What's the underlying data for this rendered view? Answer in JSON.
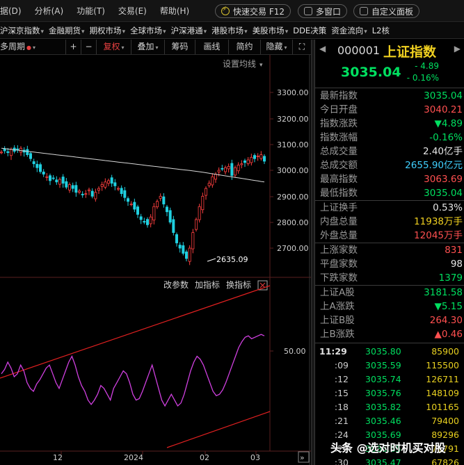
{
  "menu": {
    "items": [
      "据(D)",
      "分析(A)",
      "功能(T)",
      "交易(E)",
      "帮助(H)"
    ],
    "quick_trade": "快速交易 F12",
    "multi_window": "多窗口",
    "custom_panel": "自定义面板"
  },
  "markets": [
    {
      "label": "沪深京指数",
      "caret": true
    },
    {
      "label": "金融期货",
      "caret": true
    },
    {
      "label": "期权市场",
      "caret": true
    },
    {
      "label": "全球市场",
      "caret": true
    },
    {
      "label": "沪深港通",
      "caret": true
    },
    {
      "label": "港股市场",
      "caret": true
    },
    {
      "label": "美股市场",
      "caret": true
    },
    {
      "label": "DDE决策",
      "caret": false
    },
    {
      "label": "资金流向",
      "caret": true
    },
    {
      "label": "L2核",
      "caret": false
    }
  ],
  "toolbar": {
    "period": "多周期",
    "plus": "+",
    "minus": "−",
    "restore": "复权",
    "overlay": "叠加",
    "chips": "筹码",
    "draw": "画线",
    "simple": "简约",
    "hide": "隐藏",
    "expand": "⛶"
  },
  "chart": {
    "ma_settings": "设置均线",
    "price_axis": [
      "3300.00",
      "3200.00",
      "3100.00",
      "3000.00",
      "2900.00",
      "2800.00",
      "2700.00"
    ],
    "low_marker": "2635.09",
    "indicator_buttons": [
      "改参数",
      "加指标",
      "换指标"
    ],
    "indicator_axis": "50.00",
    "date_axis": [
      "12",
      "2024",
      "02",
      "03"
    ]
  },
  "quote": {
    "code": "000001",
    "name": "上证指数",
    "price": "3035.04",
    "change": "- 4.89",
    "change_pct": "- 0.16%",
    "stats": [
      {
        "label": "最新指数",
        "value": "3035.04",
        "color": "g"
      },
      {
        "label": "今日开盘",
        "value": "3040.21",
        "color": "r"
      },
      {
        "label": "指数涨跌",
        "value": "▼4.89",
        "color": "g"
      },
      {
        "label": "指数涨幅",
        "value": "-0.16%",
        "color": "g"
      },
      {
        "label": "总成交量",
        "value": "2.40亿手",
        "color": "w"
      },
      {
        "label": "总成交额",
        "value": "2655.90亿元",
        "color": "c"
      },
      {
        "label": "最高指数",
        "value": "3063.69",
        "color": "r"
      },
      {
        "label": "最低指数",
        "value": "3035.04",
        "color": "g"
      },
      {
        "label": "上证换手",
        "value": "0.53%",
        "color": "w"
      },
      {
        "label": "内盘总量",
        "value": "11938万手",
        "color": "y"
      },
      {
        "label": "外盘总量",
        "value": "12045万手",
        "color": "r"
      },
      {
        "label": "上涨家数",
        "value": "831",
        "color": "r"
      },
      {
        "label": "平盘家数",
        "value": "98",
        "color": "w"
      },
      {
        "label": "下跌家数",
        "value": "1379",
        "color": "g"
      },
      {
        "label": "上证A股",
        "value": "3181.58",
        "color": "g"
      },
      {
        "label": "上A涨跌",
        "value": "▼5.15",
        "color": "g"
      },
      {
        "label": "上证B股",
        "value": "264.30",
        "color": "r"
      },
      {
        "label": "上B涨跌",
        "value": "▲0.46",
        "color": "r"
      }
    ],
    "ticks": [
      {
        "time": "11:29",
        "price": "3035.80",
        "vol": "85900"
      },
      {
        "time": ":09",
        "price": "3035.59",
        "vol": "115500"
      },
      {
        "time": ":12",
        "price": "3035.74",
        "vol": "126711"
      },
      {
        "time": ":15",
        "price": "3035.76",
        "vol": "148109"
      },
      {
        "time": ":18",
        "price": "3035.82",
        "vol": "101165"
      },
      {
        "time": ":21",
        "price": "3035.46",
        "vol": "79400"
      },
      {
        "time": ":24",
        "price": "3035.69",
        "vol": "89296"
      },
      {
        "time": ":27",
        "price": "3035.65",
        "vol": "71791"
      },
      {
        "time": ":30",
        "price": "3035.47",
        "vol": "67826"
      }
    ]
  },
  "watermark": "头条 @选对时机买对股"
}
